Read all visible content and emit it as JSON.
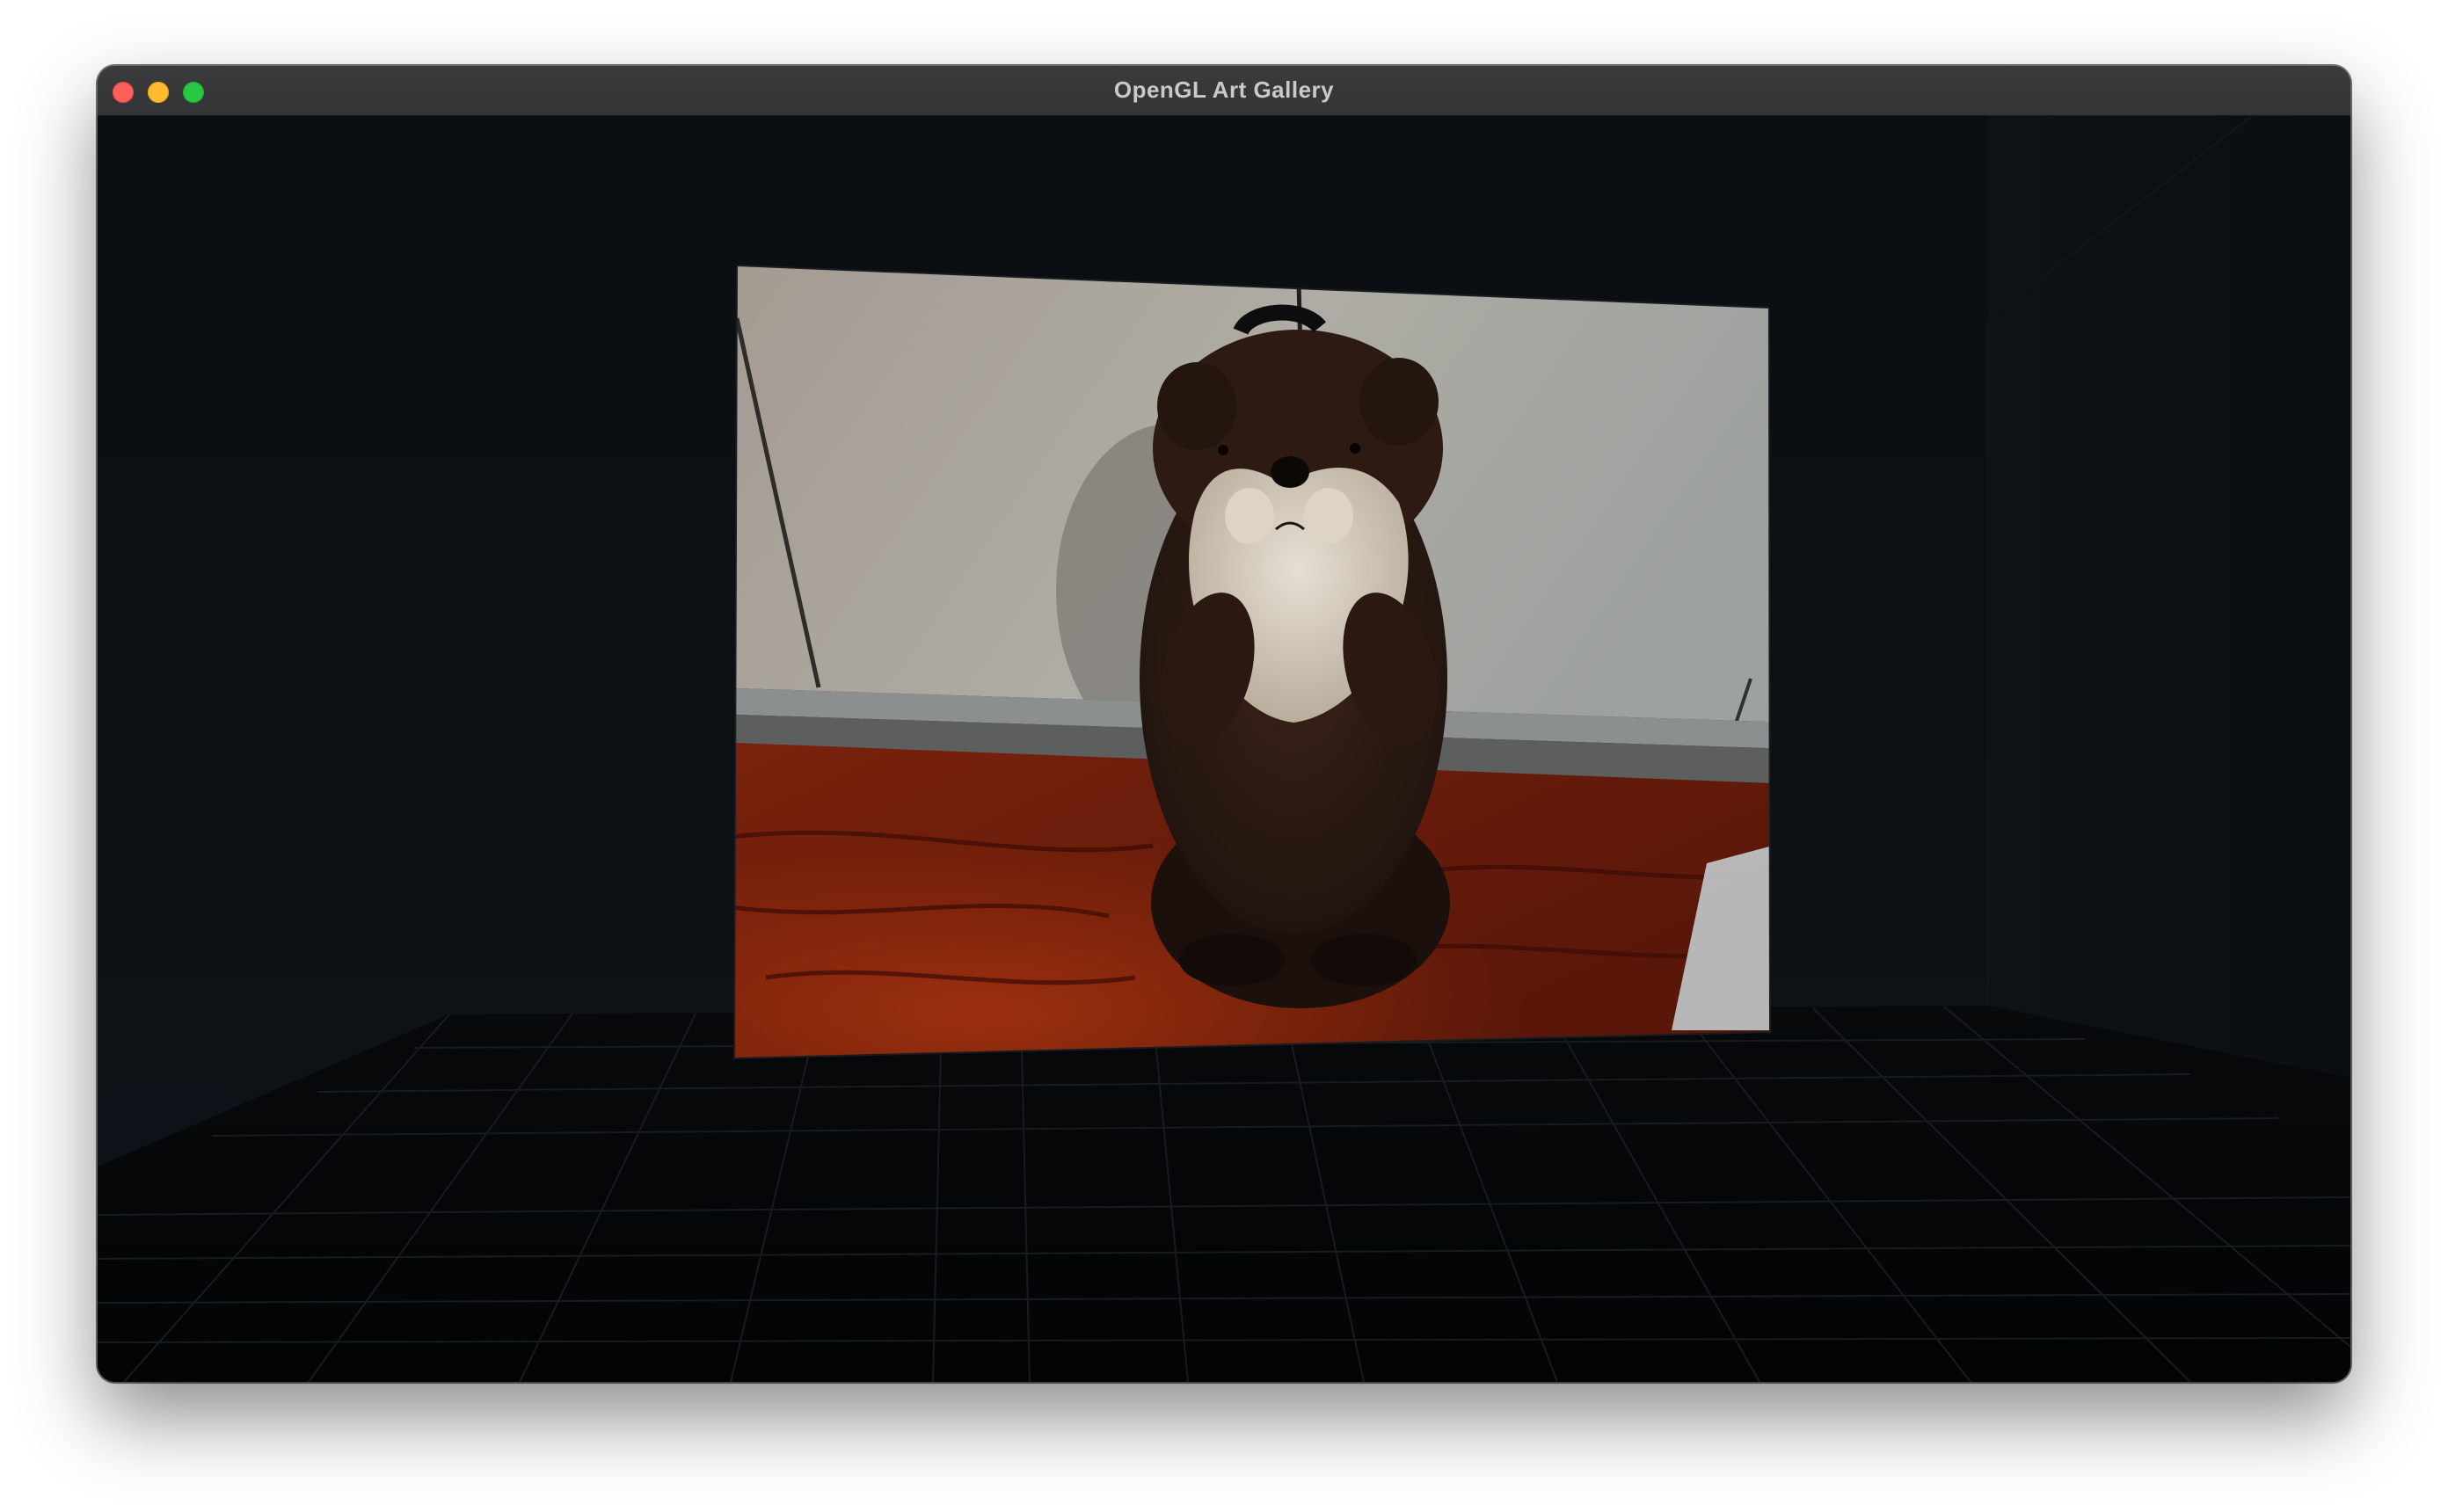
{
  "window": {
    "title": "OpenGL Art Gallery",
    "controls": [
      "close",
      "minimize",
      "zoom"
    ]
  },
  "scene": {
    "artwork_subject": "plush otter toy standing on wooden floor against white cabinets",
    "colors": {
      "wall": "#0b0f13",
      "floor": "#050607",
      "grid_line": "#1b2024",
      "frame_wall": "#b7b4ad",
      "wood_floor": "#6a1a0c"
    }
  }
}
